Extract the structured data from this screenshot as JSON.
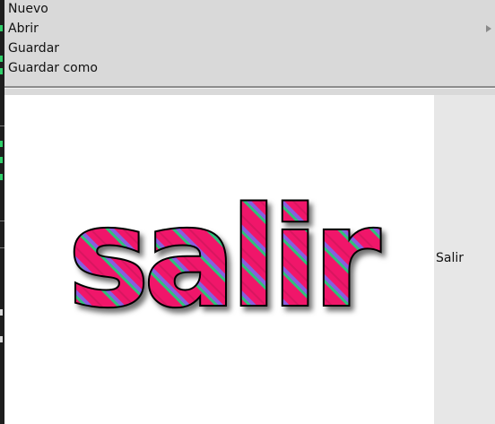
{
  "menu": {
    "items": [
      {
        "label": "Nuevo"
      },
      {
        "label": "Abrir"
      },
      {
        "label": "Guardar"
      },
      {
        "label": "Guardar como"
      }
    ],
    "submenu_arrow_icon": "triangle-right-icon"
  },
  "content": {
    "image_text": "salir",
    "side_label": "Salir"
  },
  "colors": {
    "menu_bg": "#d9d9d9",
    "image_bg": "#ffffff",
    "stripe_pink": "#f0166a",
    "stripe_green": "#2ec27a",
    "stripe_purple": "#8a5ce0",
    "outline": "#000000"
  }
}
